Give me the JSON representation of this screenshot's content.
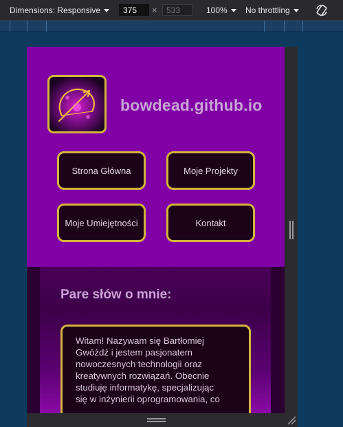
{
  "devtools": {
    "dimensions_label": "Dimensions: Responsive",
    "width_value": "375",
    "height_placeholder": "533",
    "times": "×",
    "zoom": "100%",
    "throttling": "No throttling"
  },
  "site": {
    "title": "bowdead.github.io",
    "nav": {
      "home": "Strona Główna",
      "projects": "Moje Projekty",
      "skills": "Moje Umiejętności",
      "contact": "Kontakt"
    },
    "about": {
      "heading": "Pare słów o mnie:",
      "lines": [
        "Witam! Nazywam się Bartłomiej",
        "Gwóźdź i jestem pasjonatem",
        "nowoczesnych technologii oraz",
        "kreatywnych rozwiązań. Obecnie",
        "studiuję informatykę, specjalizując",
        "się w inżynierii oprogramowania, co"
      ]
    }
  },
  "colors": {
    "header_purple": "#8000a6",
    "gold_border": "#d4b43a",
    "button_bg": "#1c0318",
    "title_text": "#c9a4d6"
  }
}
